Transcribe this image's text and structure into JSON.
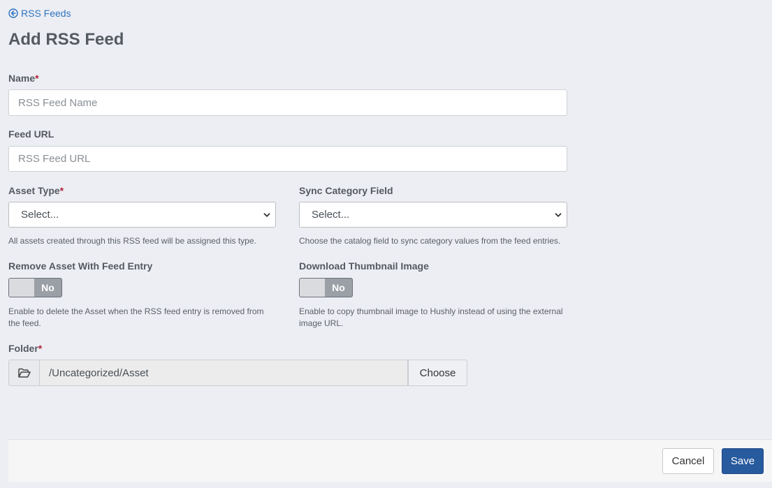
{
  "nav": {
    "back_label": "RSS Feeds"
  },
  "page": {
    "title": "Add RSS Feed"
  },
  "form": {
    "name": {
      "label": "Name",
      "required_mark": "*",
      "placeholder": "RSS Feed Name",
      "value": ""
    },
    "feed_url": {
      "label": "Feed URL",
      "placeholder": "RSS Feed URL",
      "value": ""
    },
    "asset_type": {
      "label": "Asset Type",
      "required_mark": "*",
      "selected": "Select...",
      "help": "All assets created through this RSS feed will be assigned this type."
    },
    "sync_category": {
      "label": "Sync Category Field",
      "selected": "Select...",
      "help": "Choose the catalog field to sync category values from the feed entries."
    },
    "remove_asset": {
      "label": "Remove Asset With Feed Entry",
      "toggle_text": "No",
      "help_line1": "Enable to delete the Asset when the RSS feed entry is removed from",
      "help_line2": "the feed."
    },
    "download_thumbnail": {
      "label": "Download Thumbnail Image",
      "toggle_text": "No",
      "help_line1": "Enable to copy thumbnail image to Hushly instead of using the external",
      "help_line2": "image URL."
    },
    "folder": {
      "label": "Folder",
      "required_mark": "*",
      "path": "/Uncategorized/Asset",
      "choose_label": "Choose"
    }
  },
  "footer": {
    "cancel_label": "Cancel",
    "save_label": "Save"
  },
  "icons": {
    "back": "arrow-circle-left-icon",
    "folder": "folder-open-icon",
    "dropdown": "chevron-down-icon"
  },
  "colors": {
    "link": "#2f74c0",
    "required": "#b0243a",
    "primary": "#285a9e"
  }
}
